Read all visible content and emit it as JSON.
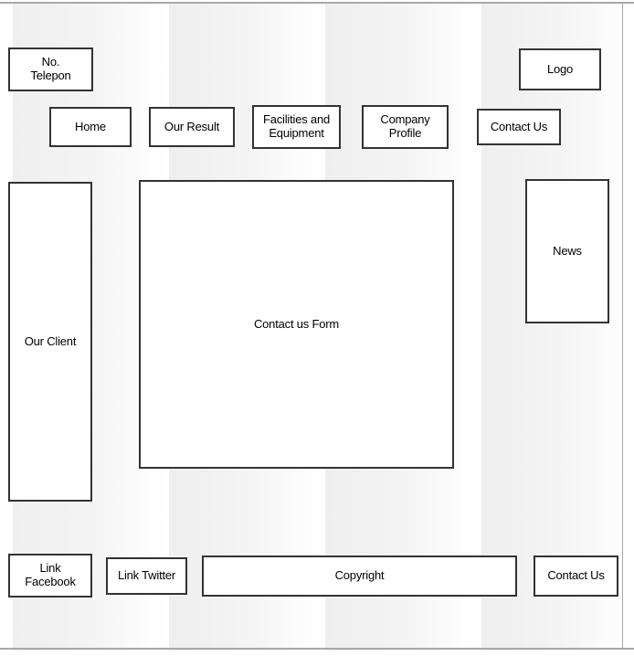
{
  "header": {
    "phone_label": "No.\nTelepon",
    "logo_label": "Logo"
  },
  "nav": {
    "items": [
      {
        "label": "Home"
      },
      {
        "label": "Our Result"
      },
      {
        "label": "Facilities and\nEquipment"
      },
      {
        "label": "Company\nProfile"
      },
      {
        "label": "Contact Us"
      }
    ]
  },
  "body": {
    "client_label": "Our Client",
    "form_label": "Contact us Form",
    "news_label": "News"
  },
  "footer": {
    "facebook_label": "Link\nFacebook",
    "twitter_label": "Link Twitter",
    "copyright_label": "Copyright",
    "contact_label": "Contact Us"
  },
  "colors": {
    "box_border": "#333333",
    "box_fill": "#ffffff",
    "frame_line": "#a8a8a8",
    "stripe_light": "#efefef",
    "stripe_white": "#ffffff"
  }
}
